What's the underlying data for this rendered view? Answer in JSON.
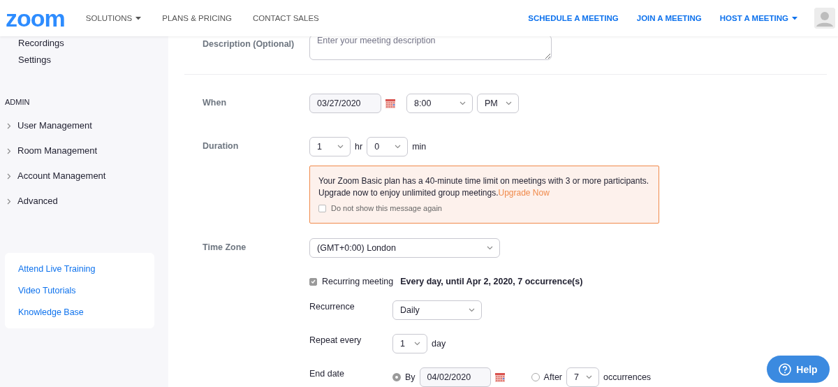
{
  "header": {
    "logo": "zoom",
    "nav": [
      {
        "label": "SOLUTIONS",
        "dropdown": true
      },
      {
        "label": "PLANS & PRICING",
        "dropdown": false
      },
      {
        "label": "CONTACT SALES",
        "dropdown": false
      }
    ],
    "actions": [
      {
        "label": "SCHEDULE A MEETING",
        "dropdown": false
      },
      {
        "label": "JOIN A MEETING",
        "dropdown": false
      },
      {
        "label": "HOST A MEETING",
        "dropdown": true
      }
    ]
  },
  "sidebar": {
    "items": [
      {
        "label": "Recordings"
      },
      {
        "label": "Settings"
      }
    ],
    "admin_heading": "ADMIN",
    "admin_items": [
      {
        "label": "User Management",
        "expanded": false
      },
      {
        "label": "Room Management",
        "expanded": false
      },
      {
        "label": "Account Management",
        "expanded": false
      },
      {
        "label": "Advanced",
        "expanded": false
      }
    ],
    "help_links": [
      "Attend Live Training",
      "Video Tutorials",
      "Knowledge Base"
    ]
  },
  "form": {
    "description": {
      "label": "Description (Optional)",
      "placeholder": "Enter your meeting description"
    },
    "when": {
      "label": "When",
      "date": "03/27/2020",
      "time": "8:00",
      "period": "PM"
    },
    "duration": {
      "label": "Duration",
      "hours": "1",
      "hours_unit": "hr",
      "minutes": "0",
      "minutes_unit": "min"
    },
    "notice": {
      "text": "Your Zoom Basic plan has a 40-minute time limit on meetings with 3 or more participants. Upgrade now to enjoy unlimited group meetings.",
      "link": "Upgrade Now",
      "checkbox_label": "Do not show this message again",
      "checked": false
    },
    "time_zone": {
      "label": "Time Zone",
      "value": "(GMT+0:00) London"
    },
    "recurring": {
      "label": "Recurring meeting",
      "checked": true,
      "summary": "Every day, until Apr 2, 2020, 7 occurrence(s)"
    },
    "recurrence": {
      "label": "Recurrence",
      "value": "Daily"
    },
    "repeat_every": {
      "label": "Repeat every",
      "value": "1",
      "unit": "day"
    },
    "end_date": {
      "label": "End date",
      "options": [
        {
          "kind": "date",
          "label": "By",
          "selected": true,
          "value": "04/02/2020"
        },
        {
          "kind": "count",
          "label": "After",
          "selected": false,
          "value": "7",
          "unit": "occurrences"
        }
      ]
    }
  },
  "help_button": "Help"
}
